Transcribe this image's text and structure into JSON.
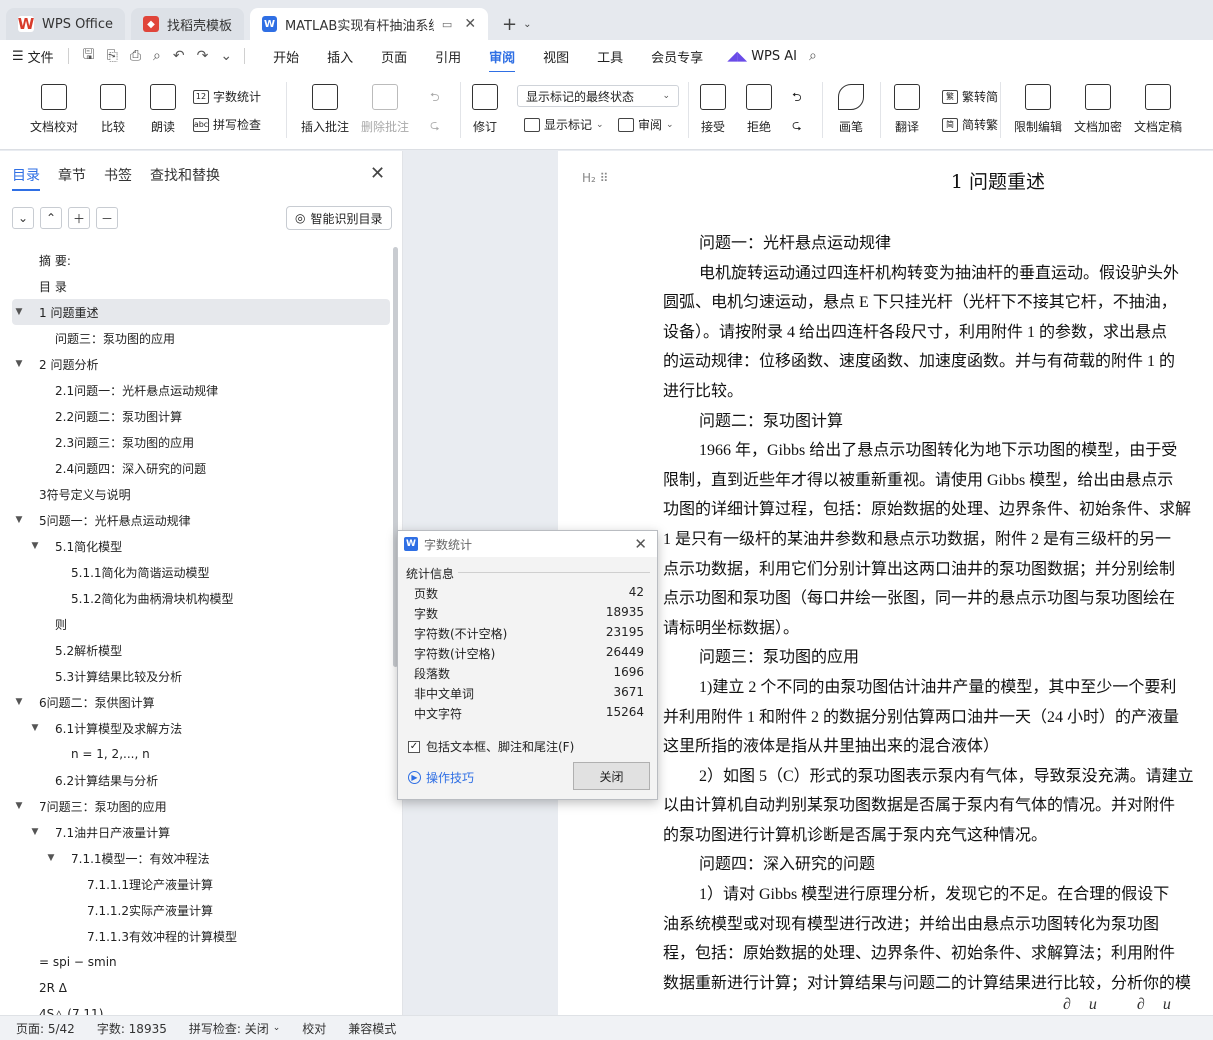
{
  "tabs": [
    {
      "label": "WPS Office",
      "icon": "wps-logo-icon"
    },
    {
      "label": "找稻壳模板",
      "icon": "daoke-icon"
    },
    {
      "label": "MATLAB实现有杆抽油系统的泵功图分析",
      "icon": "word-doc-icon"
    }
  ],
  "menubar": {
    "file": "文件",
    "tabs": [
      "开始",
      "插入",
      "页面",
      "引用",
      "审阅",
      "视图",
      "工具",
      "会员专享"
    ],
    "active_tab": "审阅",
    "ai": "WPS AI"
  },
  "ribbon": {
    "doc_check": "文档校对",
    "compare": "比较",
    "read_aloud": "朗读",
    "word_count": "字数统计",
    "spell_check": "拼写检查",
    "insert_comment": "插入批注",
    "delete_comment": "删除批注",
    "revise": "修订",
    "markup_state": "显示标记的最终状态",
    "show_markup": "显示标记",
    "review_pane": "审阅",
    "accept": "接受",
    "reject": "拒绝",
    "pen": "画笔",
    "translate": "翻译",
    "to_traditional": "繁转简",
    "to_simplified": "简转繁",
    "restrict_edit": "限制编辑",
    "encrypt": "文档加密",
    "finalize": "文档定稿"
  },
  "sidebar": {
    "tabs": [
      "目录",
      "章节",
      "书签",
      "查找和替换"
    ],
    "smart_toc": "智能识别目录",
    "toc": [
      {
        "label": "摘  要:",
        "level": 1,
        "arrow": ""
      },
      {
        "label": "目  录",
        "level": 1,
        "arrow": ""
      },
      {
        "label": "1 问题重述",
        "level": 1,
        "arrow": "▼",
        "selected": true
      },
      {
        "label": "问题三：泵功图的应用",
        "level": 2,
        "arrow": ""
      },
      {
        "label": "2 问题分析",
        "level": 1,
        "arrow": "▼"
      },
      {
        "label": "2.1问题一：光杆悬点运动规律",
        "level": 2,
        "arrow": ""
      },
      {
        "label": "2.2问题二：泵功图计算",
        "level": 2,
        "arrow": ""
      },
      {
        "label": "2.3问题三：泵功图的应用",
        "level": 2,
        "arrow": ""
      },
      {
        "label": "2.4问题四：深入研究的问题",
        "level": 2,
        "arrow": ""
      },
      {
        "label": "3符号定义与说明",
        "level": 1,
        "arrow": ""
      },
      {
        "label": "5问题一：光杆悬点运动规律",
        "level": 1,
        "arrow": "▼"
      },
      {
        "label": "5.1简化模型",
        "level": 2,
        "arrow": "▼"
      },
      {
        "label": "5.1.1简化为简谐运动模型",
        "level": 3,
        "arrow": ""
      },
      {
        "label": "5.1.2简化为曲柄滑块机构模型",
        "level": 3,
        "arrow": ""
      },
      {
        "label": "则",
        "level": 2,
        "arrow": ""
      },
      {
        "label": "5.2解析模型",
        "level": 2,
        "arrow": ""
      },
      {
        "label": "5.3计算结果比较及分析",
        "level": 2,
        "arrow": ""
      },
      {
        "label": "6问题二：泵供图计算",
        "level": 1,
        "arrow": "▼"
      },
      {
        "label": "6.1计算模型及求解方法",
        "level": 2,
        "arrow": "▼"
      },
      {
        "label": "n = 1, 2,..., n",
        "level": 3,
        "arrow": ""
      },
      {
        "label": "6.2计算结果与分析",
        "level": 2,
        "arrow": ""
      },
      {
        "label": "7问题三：泵功图的应用",
        "level": 1,
        "arrow": "▼"
      },
      {
        "label": "7.1油井日产液量计算",
        "level": 2,
        "arrow": "▼"
      },
      {
        "label": "7.1.1模型一：有效冲程法",
        "level": 3,
        "arrow": "▼"
      },
      {
        "label": "7.1.1.1理论产液量计算",
        "level": 4,
        "arrow": ""
      },
      {
        "label": "7.1.1.2实际产液量计算",
        "level": 4,
        "arrow": ""
      },
      {
        "label": "7.1.1.3有效冲程的计算模型",
        "level": 4,
        "arrow": ""
      },
      {
        "label": "= spi − smin",
        "level": 1,
        "arrow": ""
      },
      {
        "label": "2R Δ",
        "level": 1,
        "arrow": ""
      },
      {
        "label": "4S△ (7.11)",
        "level": 1,
        "arrow": ""
      }
    ]
  },
  "document": {
    "heading_marker": "H₂",
    "title": "1  问题重述",
    "lines": [
      {
        "text": "问题一：光杆悬点运动规律",
        "indent": true
      },
      {
        "text": "电机旋转运动通过四连杆机构转变为抽油杆的垂直运动。假设驴头外",
        "indent": true
      },
      {
        "text": "圆弧、电机匀速运动，悬点 E 下只挂光杆（光杆下不接其它杆，不抽油，",
        "indent": false
      },
      {
        "text": "设备）。请按附录 4 给出四连杆各段尺寸，利用附件 1 的参数，求出悬点",
        "indent": false
      },
      {
        "text": "的运动规律：位移函数、速度函数、加速度函数。并与有荷载的附件 1 的",
        "indent": false
      },
      {
        "text": "进行比较。",
        "indent": false
      },
      {
        "text": "问题二：泵功图计算",
        "indent": true
      },
      {
        "text": "1966 年，Gibbs 给出了悬点示功图转化为地下示功图的模型，由于受",
        "indent": true
      },
      {
        "text": "限制，直到近些年才得以被重新重视。请使用 Gibbs 模型，给出由悬点示",
        "indent": false
      },
      {
        "text": "功图的详细计算过程，包括：原始数据的处理、边界条件、初始条件、求解",
        "indent": false
      },
      {
        "text": "1 是只有一级杆的某油井参数和悬点示功数据，附件 2 是有三级杆的另一",
        "indent": false
      },
      {
        "text": "点示功数据，利用它们分别计算出这两口油井的泵功图数据；并分别绘制",
        "indent": false
      },
      {
        "text": "点示功图和泵功图（每口井绘一张图，同一井的悬点示功图与泵功图绘在",
        "indent": false
      },
      {
        "text": "请标明坐标数据）。",
        "indent": false
      },
      {
        "text": "问题三：泵功图的应用",
        "indent": true
      },
      {
        "text": "1)建立 2 个不同的由泵功图估计油井产量的模型，其中至少一个要利",
        "indent": true
      },
      {
        "text": "并利用附件 1 和附件 2 的数据分别估算两口油井一天（24 小时）的产液量",
        "indent": false
      },
      {
        "text": "这里所指的液体是指从井里抽出来的混合液体）",
        "indent": false
      },
      {
        "text": "2）如图 5（C）形式的泵功图表示泵内有气体，导致泵没充满。请建立",
        "indent": true
      },
      {
        "text": "以由计算机自动判别某泵功图数据是否属于泵内有气体的情况。并对附件",
        "indent": false
      },
      {
        "text": "的泵功图进行计算机诊断是否属于泵内充气这种情况。",
        "indent": false
      },
      {
        "text": "问题四：深入研究的问题",
        "indent": true
      },
      {
        "text": "1）请对 Gibbs 模型进行原理分析，发现它的不足。在合理的假设下",
        "indent": true
      },
      {
        "text": "油系统模型或对现有模型进行改进；并给出由悬点示功图转化为泵功图",
        "indent": false
      },
      {
        "text": "程，包括：原始数据的处理、边界条件、初始条件、求解算法；利用附件",
        "indent": false
      },
      {
        "text": "数据重新进行计算；对计算结果与问题二的计算结果进行比较，分析你的模",
        "indent": false
      }
    ],
    "formula_fragment": "∂u ∂u ∂u"
  },
  "dialog": {
    "title": "字数统计",
    "section": "统计信息",
    "stats": [
      {
        "label": "页数",
        "value": "42"
      },
      {
        "label": "字数",
        "value": "18935"
      },
      {
        "label": "字符数(不计空格)",
        "value": "23195"
      },
      {
        "label": "字符数(计空格)",
        "value": "26449"
      },
      {
        "label": "段落数",
        "value": "1696"
      },
      {
        "label": "非中文单词",
        "value": "3671"
      },
      {
        "label": "中文字符",
        "value": "15264"
      }
    ],
    "include_label": "包括文本框、脚注和尾注(F)",
    "include_checked": true,
    "tips": "操作技巧",
    "close": "关闭"
  },
  "statusbar": {
    "page": "页面: 5/42",
    "words": "字数: 18935",
    "spell": "拼写检查: 关闭",
    "proof": "校对",
    "compat": "兼容模式"
  }
}
